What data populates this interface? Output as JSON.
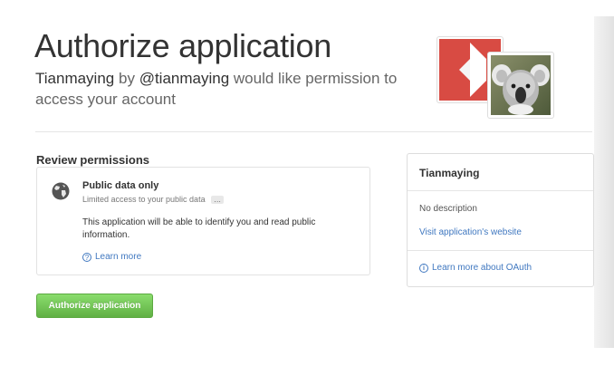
{
  "header": {
    "title": "Authorize application",
    "app_name": "Tianmaying",
    "by_text": "by",
    "username": "@tianmaying",
    "request_text": "would like permission to access your account"
  },
  "review": {
    "heading": "Review permissions",
    "permission": {
      "icon": "globe-icon",
      "title": "Public data only",
      "subtitle": "Limited access to your public data",
      "ellipsis": "…",
      "description": "This application will be able to identify you and read public information.",
      "learn_more": "Learn more"
    }
  },
  "authorize_button": "Authorize application",
  "app_info": {
    "name": "Tianmaying",
    "description": "No description",
    "website_link": "Visit application's website",
    "oauth_link": "Learn more about OAuth"
  },
  "colors": {
    "link": "#4078c0",
    "button_green": "#6cc644",
    "logo_red": "#d84b43"
  }
}
